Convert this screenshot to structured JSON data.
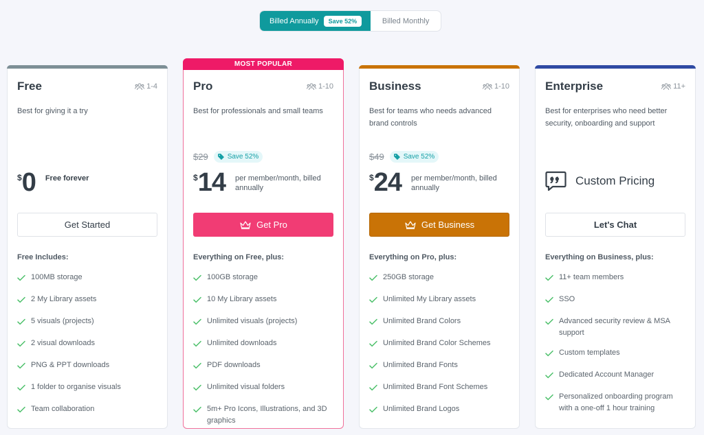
{
  "billing": {
    "annual_label": "Billed Annually",
    "annual_badge": "Save 52%",
    "monthly_label": "Billed Monthly",
    "selected": "annual"
  },
  "colors": {
    "teal": "#0f9a9d",
    "free": "#7d8f96",
    "pro": "#ee1a67",
    "business": "#c97306",
    "enterprise": "#2f4aa3",
    "check": "#4cc06a"
  },
  "plans": [
    {
      "name": "Free",
      "team_size": "1-4",
      "description": "Best for giving it a try",
      "currency": "$",
      "price": "0",
      "price_note": "Free forever",
      "cta": "Get Started",
      "features_heading": "Free Includes:",
      "features": [
        "100MB storage",
        "2 My Library assets",
        "5 visuals (projects)",
        "2 visual downloads",
        "PNG & PPT downloads",
        "1 folder to organise visuals",
        "Team collaboration"
      ]
    },
    {
      "name": "Pro",
      "badge": "MOST POPULAR",
      "team_size": "1-10",
      "description": "Best for professionals and small teams",
      "old_price": "$29",
      "save_label": "Save 52%",
      "currency": "$",
      "price": "14",
      "price_note": "per member/month, billed annually",
      "cta": "Get Pro",
      "features_heading": "Everything on Free, plus:",
      "features": [
        "100GB storage",
        "10 My Library assets",
        "Unlimited visuals (projects)",
        "Unlimited downloads",
        "PDF downloads",
        "Unlimited visual folders",
        "5m+ Pro Icons, Illustrations, and 3D graphics"
      ]
    },
    {
      "name": "Business",
      "team_size": "1-10",
      "description": "Best for teams who needs advanced brand controls",
      "old_price": "$49",
      "save_label": "Save 52%",
      "currency": "$",
      "price": "24",
      "price_note": "per member/month, billed annually",
      "cta": "Get Business",
      "features_heading": "Everything on Pro, plus:",
      "features": [
        "250GB storage",
        "Unlimited My Library assets",
        "Unlimited Brand Colors",
        "Unlimited Brand Color Schemes",
        "Unlimited Brand Fonts",
        "Unlimited Brand Font Schemes",
        "Unlimited Brand Logos"
      ]
    },
    {
      "name": "Enterprise",
      "team_size": "11+",
      "description": "Best for enterprises who need better security, onboarding and support",
      "custom_price_label": "Custom Pricing",
      "cta": "Let's Chat",
      "features_heading": "Everything on Business, plus:",
      "features": [
        "11+ team members",
        "SSO",
        "Advanced security review & MSA support",
        "Custom templates",
        "Dedicated Account Manager",
        "Personalized onboarding program with a one-off 1 hour training"
      ]
    }
  ]
}
